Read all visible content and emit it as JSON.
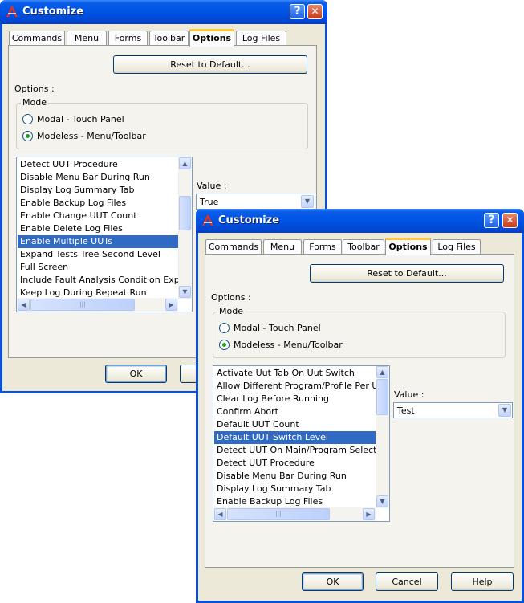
{
  "window1": {
    "title": "Customize",
    "help_btn": "?",
    "close_btn": "✕",
    "tabs": [
      "Commands",
      "Menu",
      "Forms",
      "Toolbar",
      "Options",
      "Log Files"
    ],
    "reset_button": "Reset to Default...",
    "options_label": "Options :",
    "mode_label": "Mode",
    "radio_modal": "Modal - Touch Panel",
    "radio_modeless": "Modeless - Menu/Toolbar",
    "list_items": [
      "Detect UUT Procedure",
      "Disable Menu Bar During Run",
      "Display Log Summary Tab",
      "Enable Backup Log Files",
      "Enable Change UUT Count",
      "Enable Delete Log Files",
      "Enable Multiple UUTs",
      "Expand Tests Tree Second Level",
      "Full Screen",
      "Include Fault Analysis Condition Expressi",
      "Keep Log During Repeat Run"
    ],
    "selected_item": "Enable Multiple UUTs",
    "value_label": "Value :",
    "value_selected": "True",
    "ok_button": "OK"
  },
  "window2": {
    "title": "Customize",
    "help_btn": "?",
    "close_btn": "✕",
    "tabs": [
      "Commands",
      "Menu",
      "Forms",
      "Toolbar",
      "Options",
      "Log Files"
    ],
    "reset_button": "Reset to Default...",
    "options_label": "Options :",
    "mode_label": "Mode",
    "radio_modal": "Modal - Touch Panel",
    "radio_modeless": "Modeless - Menu/Toolbar",
    "list_items": [
      "Activate Uut Tab On Uut Switch",
      "Allow Different Program/Profile Per UUT",
      "Clear Log Before Running",
      "Confirm Abort",
      "Default UUT Count",
      "Default UUT Switch Level",
      "Detect UUT On Main/Program Selection Fo",
      "Detect UUT Procedure",
      "Disable Menu Bar During Run",
      "Display Log Summary Tab",
      "Enable Backup Log Files"
    ],
    "selected_item": "Default UUT Switch Level",
    "value_label": "Value :",
    "value_selected": "Test",
    "ok_button": "OK",
    "cancel_button": "Cancel",
    "help_button": "Help"
  },
  "icons": {
    "arrow_up": "▲",
    "arrow_down": "▼",
    "arrow_left": "◀",
    "arrow_right": "▶",
    "grip": "|||"
  },
  "colors": {
    "title_blue": "#0055e5",
    "selection": "#316ac5",
    "tab_highlight": "#ffc83c",
    "dialog_bg": "#ece9d8"
  }
}
